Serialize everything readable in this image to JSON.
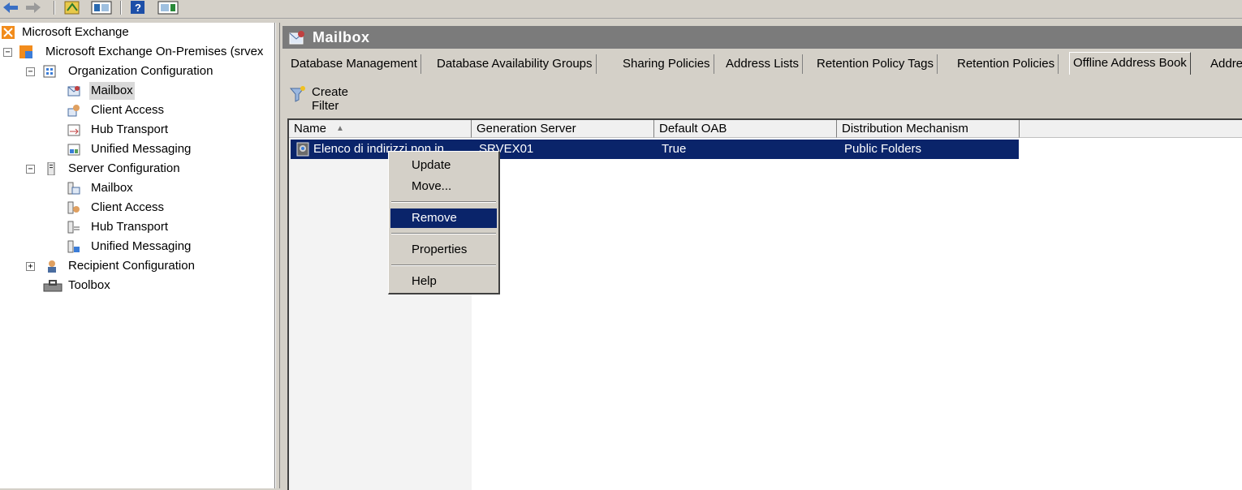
{
  "tree": {
    "items": [
      {
        "label": "Microsoft Exchange"
      },
      {
        "label": "Microsoft Exchange On-Premises (srvex"
      },
      {
        "label": "Organization Configuration"
      },
      {
        "label": "Mailbox"
      },
      {
        "label": "Client Access"
      },
      {
        "label": "Hub Transport"
      },
      {
        "label": "Unified Messaging"
      },
      {
        "label": "Server Configuration"
      },
      {
        "label": "Mailbox"
      },
      {
        "label": "Client Access"
      },
      {
        "label": "Hub Transport"
      },
      {
        "label": "Unified Messaging"
      },
      {
        "label": "Recipient Configuration"
      },
      {
        "label": "Toolbox"
      }
    ]
  },
  "panel": {
    "title": "Mailbox"
  },
  "tabs": [
    {
      "label": "Database Management"
    },
    {
      "label": "Database Availability Groups"
    },
    {
      "label": "Sharing Policies"
    },
    {
      "label": "Address Lists"
    },
    {
      "label": "Retention Policy Tags"
    },
    {
      "label": "Retention Policies"
    },
    {
      "label": "Offline Address Book"
    },
    {
      "label": "Addre"
    }
  ],
  "filter": {
    "label": "Create Filter"
  },
  "grid": {
    "columns": [
      "Name",
      "Generation Server",
      "Default OAB",
      "Distribution Mechanism"
    ],
    "sort_indicator": "▲",
    "rows": [
      {
        "name": "Elenco di indirizzi non in",
        "server": "SRVEX01",
        "default": "True",
        "mechanism": "Public Folders"
      }
    ]
  },
  "context_menu": {
    "items": [
      "Update",
      "Move...",
      "Remove",
      "Properties",
      "Help"
    ]
  },
  "colors": {
    "selection": "#0a246a",
    "header": "#7b7b7b",
    "face": "#d4d0c8"
  }
}
